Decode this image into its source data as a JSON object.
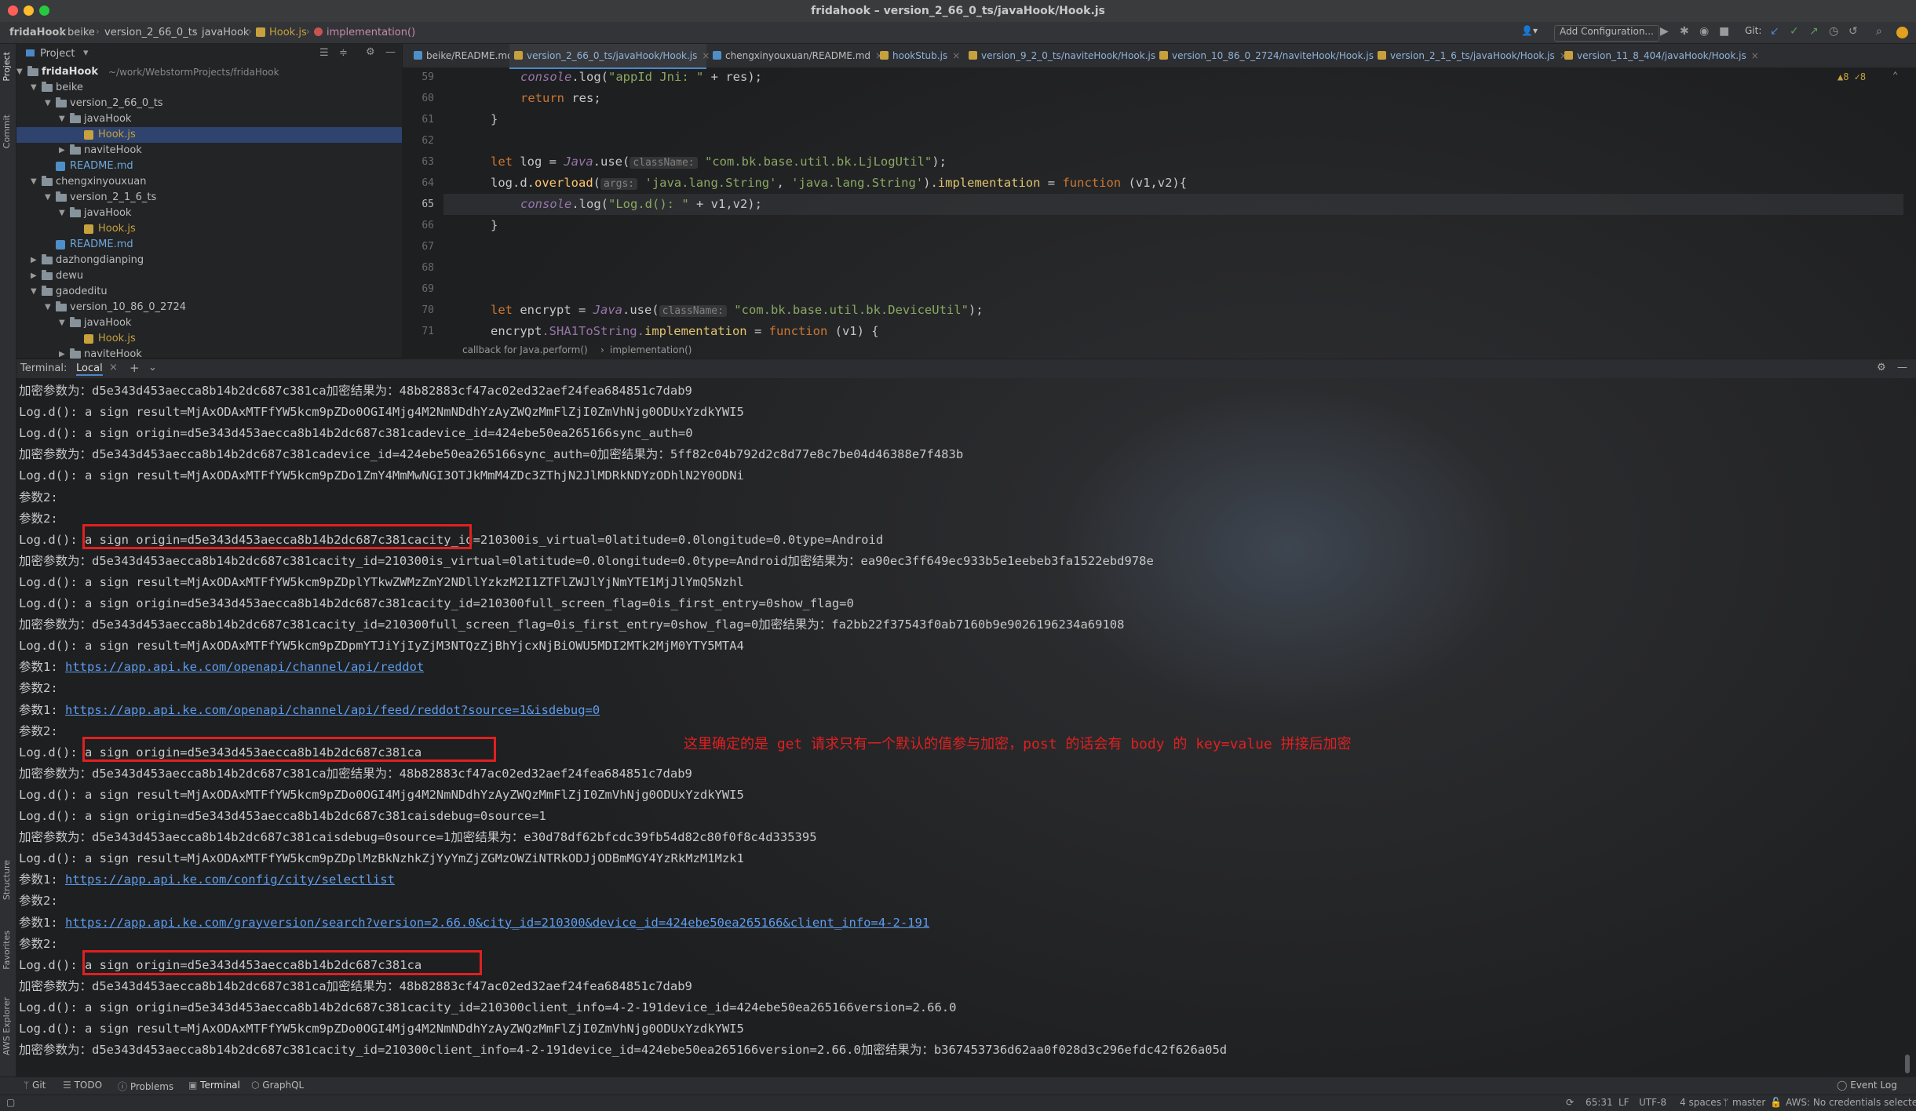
{
  "window": {
    "title": "fridahook – version_2_66_0_ts/javaHook/Hook.js"
  },
  "colors": {
    "accent": "#4a88c7",
    "annotation": "#e02020",
    "link": "#5d9cec",
    "keyword": "#cc7832",
    "string": "#8aa862"
  },
  "navbar": {
    "crumbs": [
      "fridaHook",
      "beike",
      "version_2_66_0_ts",
      "javaHook",
      "Hook.js",
      "implementation()"
    ],
    "add_config": "Add Configuration...",
    "git_label": "Git:"
  },
  "left_stripe": {
    "project": "Project",
    "commit": "Commit",
    "structure": "Structure",
    "favorites": "Favorites",
    "aws": "AWS Explorer"
  },
  "project": {
    "header": "Project",
    "tree": [
      {
        "label": "fridaHook",
        "extra": "~/work/WebstormProjects/fridaHook",
        "type": "folder",
        "depth": 0,
        "open": true
      },
      {
        "label": "beike",
        "type": "folder",
        "depth": 1,
        "open": true
      },
      {
        "label": "version_2_66_0_ts",
        "type": "folder",
        "depth": 2,
        "open": true
      },
      {
        "label": "javaHook",
        "type": "folder",
        "depth": 3,
        "open": true
      },
      {
        "label": "Hook.js",
        "type": "js",
        "depth": 4,
        "selected": true
      },
      {
        "label": "naviteHook",
        "type": "folder",
        "depth": 3
      },
      {
        "label": "README.md",
        "type": "md",
        "depth": 2
      },
      {
        "label": "chengxinyouxuan",
        "type": "folder",
        "depth": 1,
        "open": true
      },
      {
        "label": "version_2_1_6_ts",
        "type": "folder",
        "depth": 2,
        "open": true
      },
      {
        "label": "javaHook",
        "type": "folder",
        "depth": 3,
        "open": true
      },
      {
        "label": "Hook.js",
        "type": "js",
        "depth": 4
      },
      {
        "label": "README.md",
        "type": "md",
        "depth": 2
      },
      {
        "label": "dazhongdianping",
        "type": "folder",
        "depth": 1,
        "closed": true
      },
      {
        "label": "dewu",
        "type": "folder",
        "depth": 1,
        "closed": true
      },
      {
        "label": "gaodeditu",
        "type": "folder",
        "depth": 1,
        "open": true
      },
      {
        "label": "version_10_86_0_2724",
        "type": "folder",
        "depth": 2,
        "open": true
      },
      {
        "label": "javaHook",
        "type": "folder",
        "depth": 3,
        "open": true
      },
      {
        "label": "Hook.js",
        "type": "js",
        "depth": 4
      },
      {
        "label": "naviteHook",
        "type": "folder",
        "depth": 3,
        "closed": true
      }
    ]
  },
  "tabs": [
    {
      "label": "beike/README.md",
      "icon": "md"
    },
    {
      "label": "version_2_66_0_ts/javaHook/Hook.js",
      "icon": "js",
      "active": true
    },
    {
      "label": "chengxinyouxuan/README.md",
      "icon": "md"
    },
    {
      "label": "hookStub.js",
      "icon": "js"
    },
    {
      "label": "version_9_2_0_ts/naviteHook/Hook.js",
      "icon": "js"
    },
    {
      "label": "version_10_86_0_2724/naviteHook/Hook.js",
      "icon": "js"
    },
    {
      "label": "version_2_1_6_ts/javaHook/Hook.js",
      "icon": "js"
    },
    {
      "label": "version_11_8_404/javaHook/Hook.js",
      "icon": "js"
    }
  ],
  "editor": {
    "inspection": "▲8 ✓8",
    "line_numbers": [
      "59",
      "60",
      "61",
      "62",
      "63",
      "64",
      "65",
      "66",
      "67",
      "68",
      "69",
      "70",
      "71"
    ],
    "code": {
      "l59_a": "console",
      "l59_b": ".log(",
      "l59_c": "\"appId Jni: \"",
      "l59_d": " + res);",
      "l60_a": "return",
      "l60_b": " res;",
      "l61": "}",
      "l63_a": "let",
      "l63_b": " log = ",
      "l63_c": "Java",
      "l63_d": ".use(",
      "l63_hint": "className:",
      "l63_e": "\"com.bk.base.util.bk.LjLogUtil\"",
      "l63_f": ");",
      "l64_a": "log",
      "l64_b": ".d.",
      "l64_c": "overload",
      "l64_d": "(",
      "l64_hint": "args:",
      "l64_e": "'java.lang.String'",
      "l64_f": ", ",
      "l64_g": "'java.lang.String'",
      "l64_h": ").",
      "l64_i": "implementation",
      "l64_j": " = ",
      "l64_k": "function",
      "l64_l": " (v1,v2){",
      "l65_a": "console",
      "l65_b": ".log(",
      "l65_c": "\"Log.d(): \"",
      "l65_d": " + v1,v2);",
      "l66": "}",
      "l70_a": "let",
      "l70_b": " encrypt = ",
      "l70_c": "Java",
      "l70_d": ".use(",
      "l70_hint": "className:",
      "l70_e": "\"com.bk.base.util.bk.DeviceUtil\"",
      "l70_f": ");",
      "l71_a": "encrypt",
      "l71_b": ".SHA1ToString.",
      "l71_c": "implementation",
      "l71_d": " = ",
      "l71_e": "function",
      "l71_f": " (v1) {"
    },
    "breadcrumb": [
      "callback for Java.perform()",
      "implementation()"
    ]
  },
  "terminal": {
    "label": "Terminal:",
    "tab": "Local",
    "lines": [
      "加密参数为：d5e343d453aecca8b14b2dc687c381ca加密结果为：48b82883cf47ac02ed32aef24fea684851c7dab9",
      "Log.d(): a sign result=MjAxODAxMTFfYW5kcm9pZDo0OGI4Mjg4M2NmNDdhYzAyZWQzMmFlZjI0ZmVhNjg0ODUxYzdkYWI5",
      "Log.d(): a sign origin=d5e343d453aecca8b14b2dc687c381cadevice_id=424ebe50ea265166sync_auth=0",
      "加密参数为：d5e343d453aecca8b14b2dc687c381cadevice_id=424ebe50ea265166sync_auth=0加密结果为：5ff82c04b792d2c8d77e8c7be04d46388e7f483b",
      "Log.d(): a sign result=MjAxODAxMTFfYW5kcm9pZDo1ZmY4MmMwNGI3OTJkMmM4ZDc3ZThjN2JlMDRkNDYzODhlN2Y0ODNi",
      "参数2:",
      "参数2:",
      "Log.d(): a sign origin=d5e343d453aecca8b14b2dc687c381cacity_id=210300is_virtual=0latitude=0.0longitude=0.0type=Android",
      "加密参数为：d5e343d453aecca8b14b2dc687c381cacity_id=210300is_virtual=0latitude=0.0longitude=0.0type=Android加密结果为：ea90ec3ff649ec933b5e1eebeb3fa1522ebd978e",
      "Log.d(): a sign result=MjAxODAxMTFfYW5kcm9pZDplYTkwZWMzZmY2NDllYzkzM2I1ZTFlZWJlYjNmYTE1MjJlYmQ5Nzhl",
      "Log.d(): a sign origin=d5e343d453aecca8b14b2dc687c381cacity_id=210300full_screen_flag=0is_first_entry=0show_flag=0",
      "加密参数为：d5e343d453aecca8b14b2dc687c381cacity_id=210300full_screen_flag=0is_first_entry=0show_flag=0加密结果为：fa2bb22f37543f0ab7160b9e9026196234a69108",
      "Log.d(): a sign result=MjAxODAxMTFfYW5kcm9pZDpmYTJiYjIyZjM3NTQzZjBhYjcxNjBiOWU5MDI2MTk2MjM0YTY5MTA4",
      {
        "prefix": "参数1: ",
        "link": "https://app.api.ke.com/openapi/channel/api/reddot"
      },
      "参数2:",
      {
        "prefix": "参数1: ",
        "link": "https://app.api.ke.com/openapi/channel/api/feed/reddot?source=1&isdebug=0"
      },
      "参数2:",
      "Log.d(): a sign origin=d5e343d453aecca8b14b2dc687c381ca",
      "加密参数为：d5e343d453aecca8b14b2dc687c381ca加密结果为：48b82883cf47ac02ed32aef24fea684851c7dab9",
      "Log.d(): a sign result=MjAxODAxMTFfYW5kcm9pZDo0OGI4Mjg4M2NmNDdhYzAyZWQzMmFlZjI0ZmVhNjg0ODUxYzdkYWI5",
      "Log.d(): a sign origin=d5e343d453aecca8b14b2dc687c381caisdebug=0source=1",
      "加密参数为：d5e343d453aecca8b14b2dc687c381caisdebug=0source=1加密结果为：e30d78df62bfcdc39fb54d82c80f0f8c4d335395",
      "Log.d(): a sign result=MjAxODAxMTFfYW5kcm9pZDplMzBkNzhkZjYyYmZjZGMzOWZiNTRkODJjODBmMGY4YzRkMzM1Mzk1",
      {
        "prefix": "参数1: ",
        "link": "https://app.api.ke.com/config/city/selectlist"
      },
      "参数2:",
      {
        "prefix": "参数1: ",
        "link": "https://app.api.ke.com/grayversion/search?version=2.66.0&city_id=210300&device_id=424ebe50ea265166&client_info=4-2-191"
      },
      "参数2:",
      "Log.d(): a sign origin=d5e343d453aecca8b14b2dc687c381ca",
      "加密参数为：d5e343d453aecca8b14b2dc687c381ca加密结果为：48b82883cf47ac02ed32aef24fea684851c7dab9",
      "Log.d(): a sign origin=d5e343d453aecca8b14b2dc687c381cacity_id=210300client_info=4-2-191device_id=424ebe50ea265166version=2.66.0",
      "Log.d(): a sign result=MjAxODAxMTFfYW5kcm9pZDo0OGI4Mjg4M2NmNDdhYzAyZWQzMmFlZjI0ZmVhNjg0ODUxYzdkYWI5",
      "加密参数为：d5e343d453aecca8b14b2dc687c381cacity_id=210300client_info=4-2-191device_id=424ebe50ea265166version=2.66.0加密结果为：b367453736d62aa0f028d3c296efdc42f626a05d"
    ],
    "annotation": "这里确定的是 get 请求只有一个默认的值参与加密，post 的话会有 body 的 key=value 拼接后加密"
  },
  "bottom_toolbar": {
    "git": "Git",
    "todo": "TODO",
    "problems": "Problems",
    "terminal": "Terminal",
    "graphql": "GraphQL",
    "event_log": "Event Log"
  },
  "status_bar": {
    "position": "65:31",
    "line_sep": "LF",
    "encoding": "UTF-8",
    "indent": "4 spaces",
    "branch": "master",
    "aws": "AWS: No credentials selected"
  }
}
